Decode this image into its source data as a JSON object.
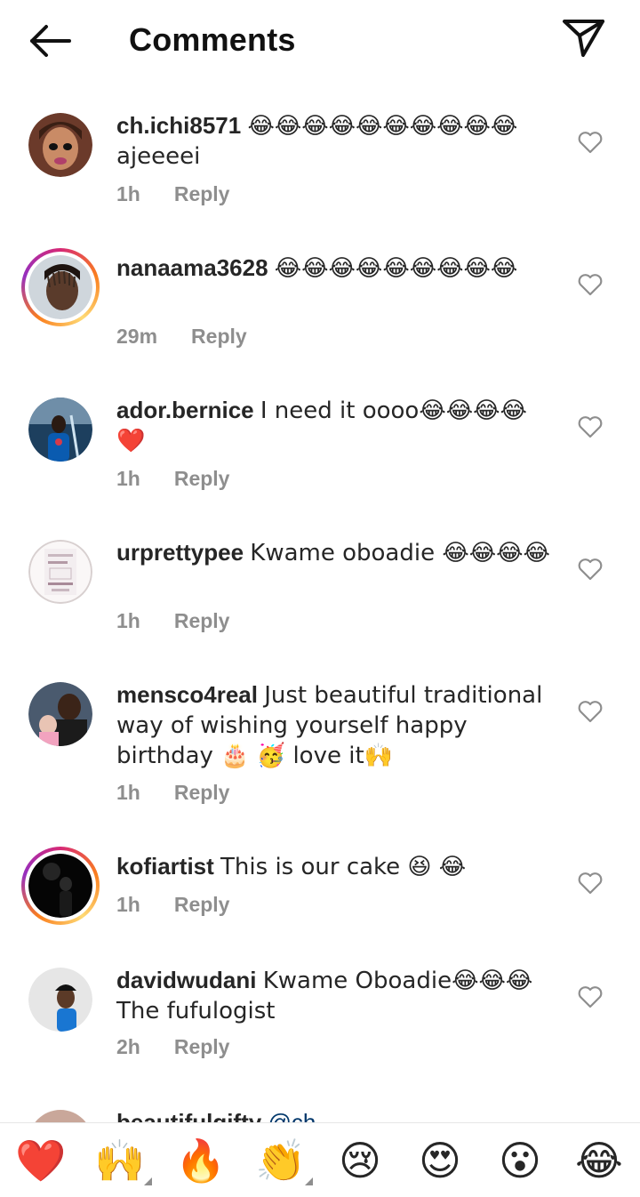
{
  "header": {
    "title": "Comments",
    "back_icon": "arrow-left-icon",
    "send_icon": "paper-plane-icon"
  },
  "comments": [
    {
      "username": "ch.ichi8571",
      "text": "😂😂😂😂😂😂😂😂😂😂ajeeeei",
      "time": "1h",
      "reply": "Reply"
    },
    {
      "username": "nanaama3628",
      "text": "😂😂😂😂😂😂😂😂😂",
      "time": "29m",
      "reply": "Reply"
    },
    {
      "username": "ador.bernice",
      "text": "I need it oooo😂😂😂😂❤️",
      "time": "1h",
      "reply": "Reply"
    },
    {
      "username": "urprettypee",
      "text": "Kwame oboadie 😂😂😂😂",
      "time": "1h",
      "reply": "Reply"
    },
    {
      "username": "mensco4real",
      "text": "Just beautiful traditional way of wishing yourself happy birthday 🎂 🥳 love it🙌",
      "time": "1h",
      "reply": "Reply"
    },
    {
      "username": "kofiartist",
      "text": "This is our cake 😆 😂",
      "time": "1h",
      "reply": "Reply"
    },
    {
      "username": "davidwudani",
      "text": "Kwame Oboadie😂😂😂 The fufulogist",
      "time": "2h",
      "reply": "Reply"
    }
  ],
  "partial_comment": {
    "username": "beautifulgifty",
    "text": "@ch"
  },
  "emoji_bar": [
    "❤️",
    "🙌",
    "🔥",
    "👏",
    "😢",
    "😍",
    "😮",
    "😂"
  ],
  "colors": {
    "text": "#262626",
    "meta": "#8e8e8e",
    "link": "#00376b"
  }
}
